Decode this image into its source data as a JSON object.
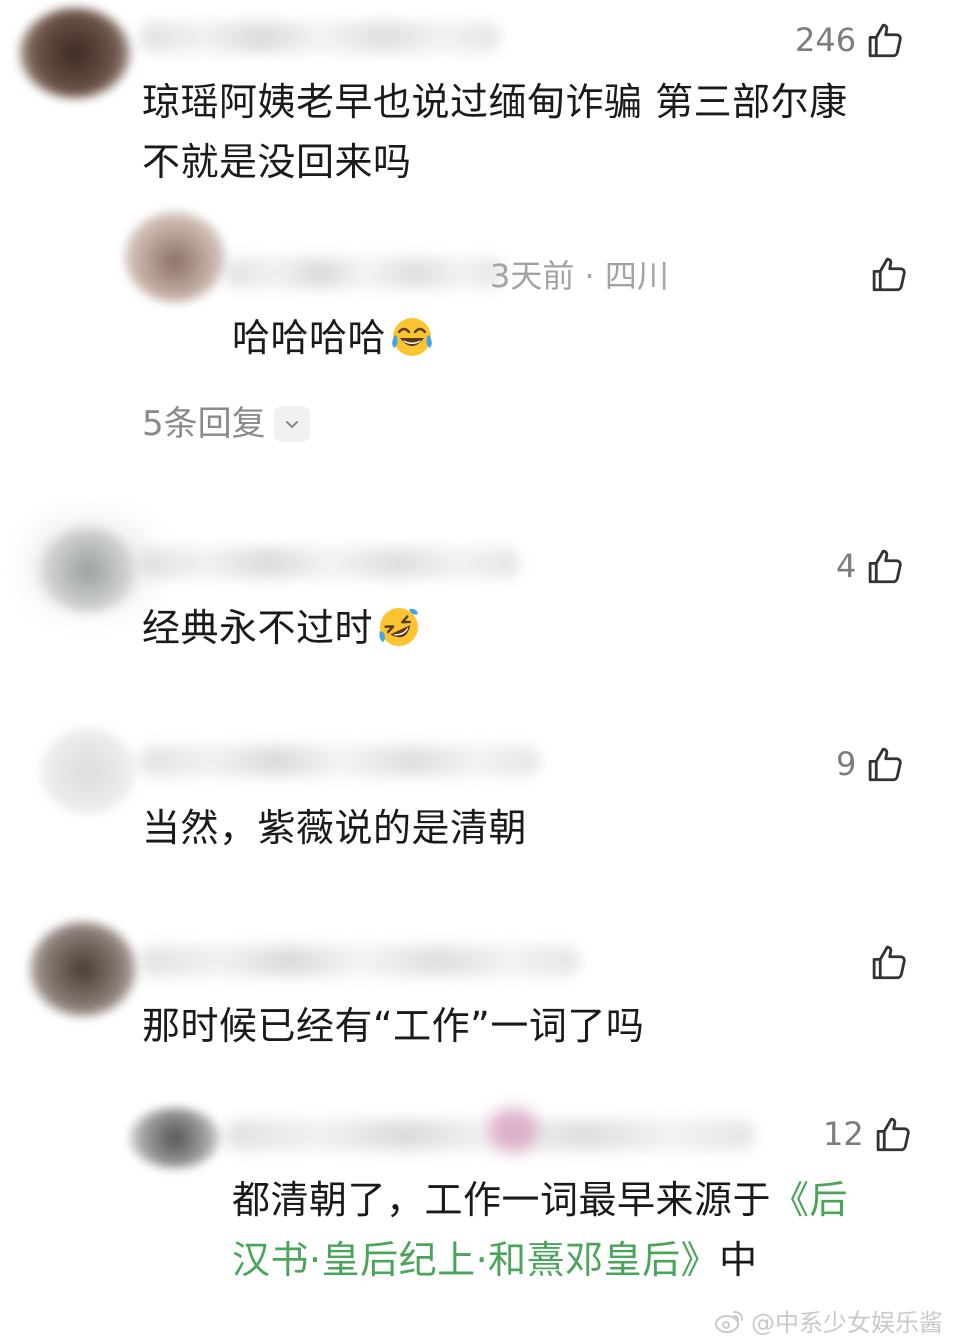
{
  "comments": [
    {
      "text_lines": [
        "琼瑶阿姨老早也说过缅甸诈骗 第三部尔康",
        "不就是没回来吗"
      ],
      "likes": "246",
      "reply": {
        "meta": "3天前 · 四川",
        "text": "哈哈哈哈",
        "emoji": "tears-of-joy-emoji",
        "likes": ""
      },
      "replies_label": "5条回复"
    },
    {
      "text": "经典永不过时",
      "emoji": "rolling-laughing-emoji",
      "likes": "4"
    },
    {
      "text": "当然，紫薇说的是清朝",
      "likes": "9"
    },
    {
      "text": "那时候已经有“工作”一词了吗",
      "likes": "",
      "reply": {
        "text_prefix": "都清朝了，工作一词最早来源于",
        "link_part1": "《后",
        "link_part2": "汉书·皇后纪上·和熹邓皇后》",
        "text_suffix": "中",
        "likes": "12"
      }
    }
  ],
  "watermark": "@中系少女娱乐酱",
  "colors": {
    "link": "#4aa55a",
    "meta": "#a3a3a3",
    "text": "#1a1a1a"
  }
}
